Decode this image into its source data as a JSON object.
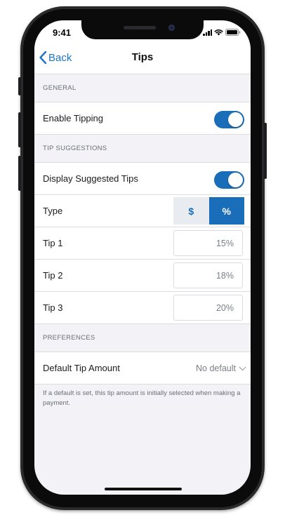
{
  "status_bar": {
    "time": "9:41",
    "icons": [
      "signal-icon",
      "wifi-icon",
      "battery-icon"
    ]
  },
  "nav": {
    "back_label": "Back",
    "title": "Tips"
  },
  "sections": {
    "general": {
      "header": "GENERAL",
      "enable_tipping": {
        "label": "Enable Tipping",
        "on": true
      }
    },
    "tip_suggestions": {
      "header": "TIP SUGGESTIONS",
      "display_suggested": {
        "label": "Display Suggested Tips",
        "on": true
      },
      "type": {
        "label": "Type",
        "options": [
          "$",
          "%"
        ],
        "selected": "%"
      },
      "tips": [
        {
          "label": "Tip 1",
          "value": "15%"
        },
        {
          "label": "Tip 2",
          "value": "18%"
        },
        {
          "label": "Tip 3",
          "value": "20%"
        }
      ]
    },
    "preferences": {
      "header": "PREFERENCES",
      "default_tip": {
        "label": "Default Tip Amount",
        "value": "No default"
      },
      "footnote": "If a default is set, this tip amount is initially selected when making a payment."
    }
  },
  "colors": {
    "accent": "#1a6db8",
    "link": "#1a74c8",
    "background": "#f2f2f7"
  }
}
